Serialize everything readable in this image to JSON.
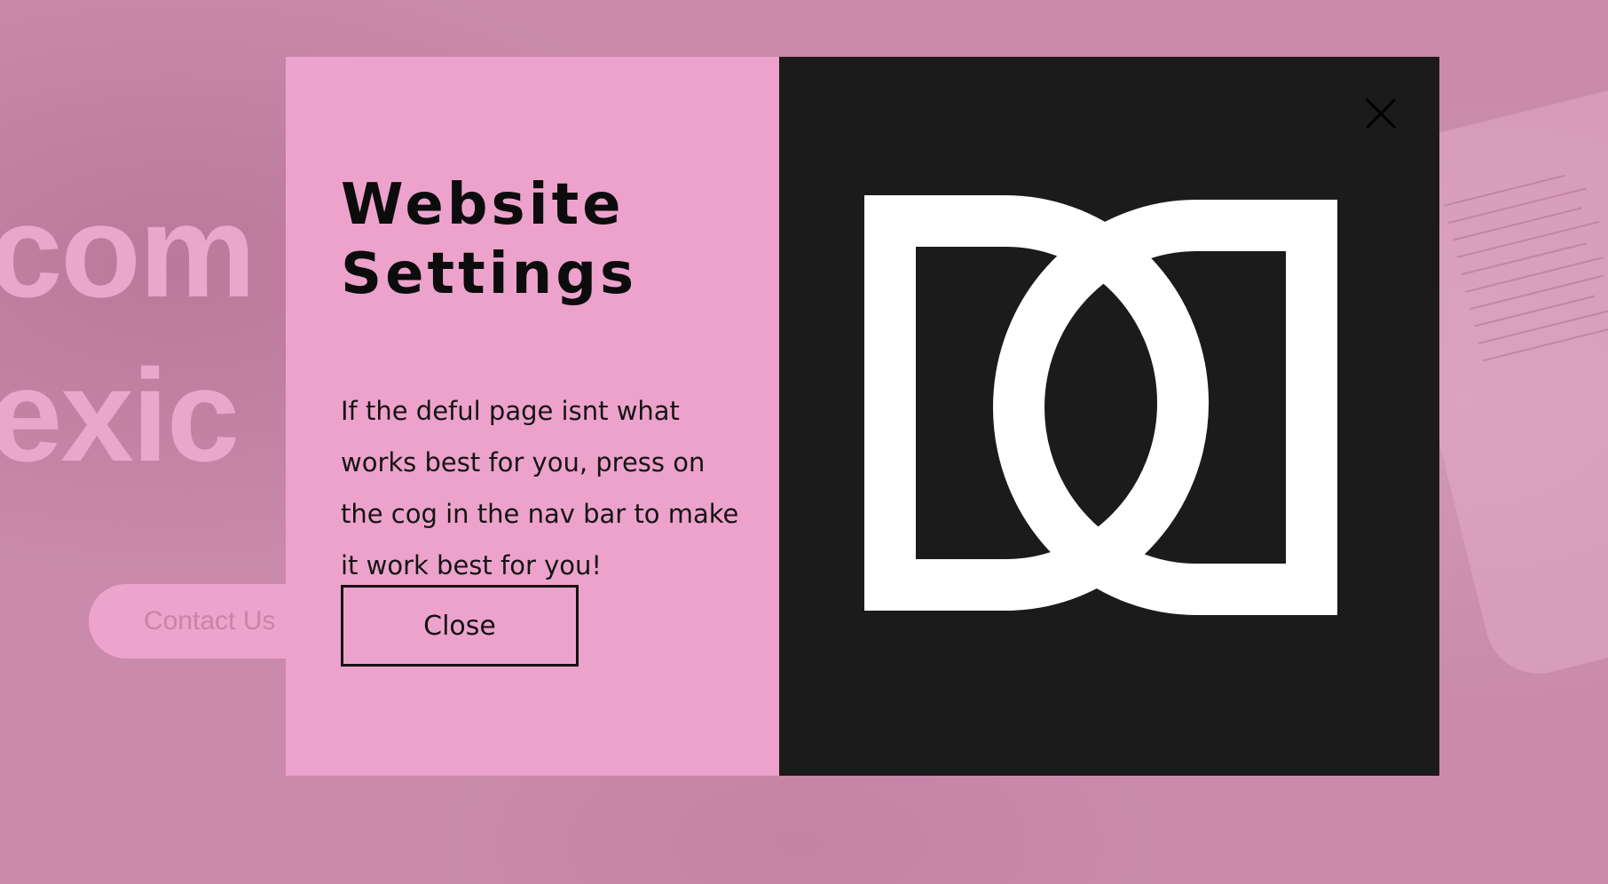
{
  "background": {
    "headline_line1": "com",
    "headline_line2": "exic",
    "contact_button_label": "Contact Us"
  },
  "modal": {
    "title_line1": "Website",
    "title_line2": "Settings",
    "message": "If the deful page isnt what works best for you, press on the cog in the nav bar to make it work best for you!",
    "close_button_label": "Close",
    "close_icon": "close-icon",
    "logo_icon": "interlocking-d-logo-icon"
  },
  "colors": {
    "page_overlay": "#c98aab",
    "modal_left_bg": "#eda2cc",
    "modal_right_bg": "#1b1b1b",
    "text": "#0c0c0c",
    "logo": "#ffffff"
  }
}
